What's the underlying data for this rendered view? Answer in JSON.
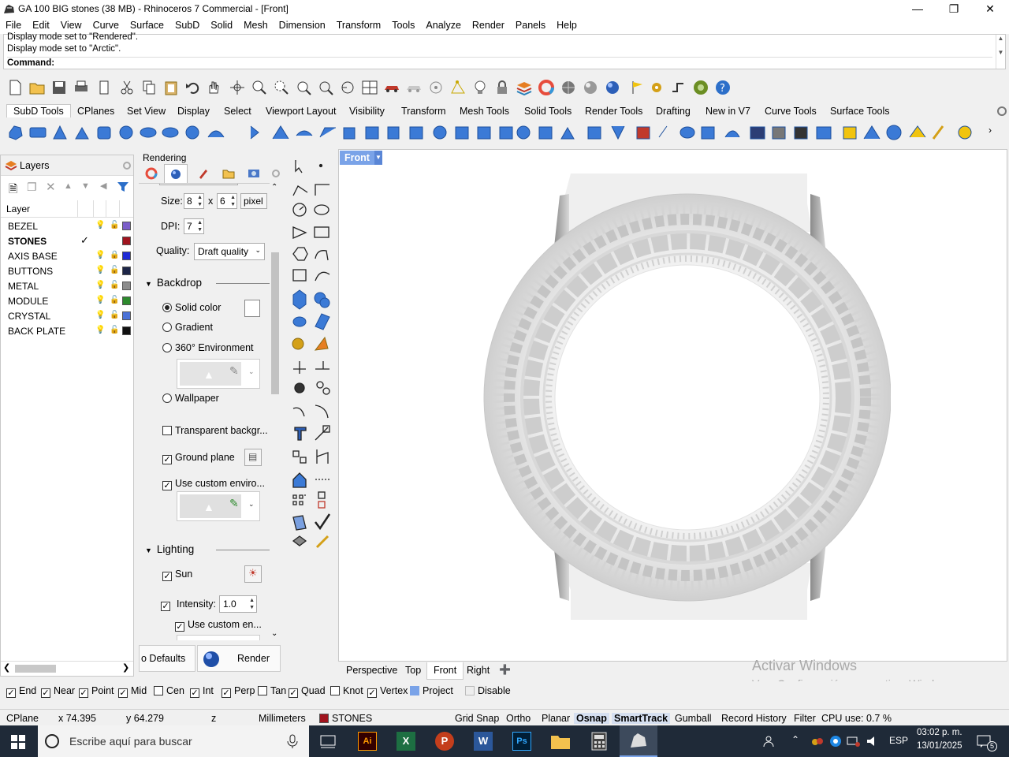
{
  "window": {
    "title": "GA 100 BIG stones (38 MB) - Rhinoceros 7 Commercial - [Front]"
  },
  "menu": [
    "File",
    "Edit",
    "View",
    "Curve",
    "Surface",
    "SubD",
    "Solid",
    "Mesh",
    "Dimension",
    "Transform",
    "Tools",
    "Analyze",
    "Render",
    "Panels",
    "Help"
  ],
  "command": {
    "history1": "Display mode set to \"Rendered\".",
    "history2": "Display mode set to \"Arctic\".",
    "prompt": "Command:"
  },
  "toolbar_tabs": [
    "SubD Tools",
    "CPlanes",
    "Set View",
    "Display",
    "Select",
    "Viewport Layout",
    "Visibility",
    "Transform",
    "Mesh Tools",
    "Solid Tools",
    "Render Tools",
    "Drafting",
    "New in V7",
    "Curve Tools",
    "Surface Tools"
  ],
  "layers": {
    "title": "Layers",
    "column_header": "Layer",
    "rows": [
      {
        "name": "BEZEL",
        "color": "#7b5ec9",
        "current": false,
        "locked": false
      },
      {
        "name": "STONES",
        "color": "#a0141e",
        "current": true,
        "locked": false
      },
      {
        "name": "AXIS BASE",
        "color": "#1f2bd6",
        "current": false,
        "locked": true
      },
      {
        "name": "BUTTONS",
        "color": "#1c2547",
        "current": false,
        "locked": false
      },
      {
        "name": "METAL",
        "color": "#8c8c8c",
        "current": false,
        "locked": false
      },
      {
        "name": "MODULE",
        "color": "#2d8a2d",
        "current": false,
        "locked": false
      },
      {
        "name": "CRYSTAL",
        "color": "#4b72d8",
        "current": false,
        "locked": false
      },
      {
        "name": "BACK PLATE",
        "color": "#111111",
        "current": false,
        "locked": false
      }
    ]
  },
  "rendering": {
    "title": "Rendering",
    "size_label": "Size:",
    "size_w": "8",
    "size_x": "x",
    "size_h": "6",
    "size_unit": "pixel",
    "dpi_label": "DPI:",
    "dpi_value": "7",
    "quality_label": "Quality:",
    "quality_value": "Draft quality",
    "backdrop_header": "Backdrop",
    "solid_color": "Solid color",
    "gradient": "Gradient",
    "env360": "360° Environment",
    "wallpaper": "Wallpaper",
    "transparent": "Transparent backgr...",
    "ground_plane": "Ground plane",
    "custom_env": "Use custom enviro...",
    "lighting_header": "Lighting",
    "sun": "Sun",
    "intensity_label": "Intensity:",
    "intensity_value": "1.0",
    "custom_env2": "Use custom en...",
    "defaults_btn": "o Defaults",
    "render_btn": "Render"
  },
  "viewport": {
    "name": "Front",
    "tabs": [
      "Perspective",
      "Top",
      "Front",
      "Right"
    ],
    "active_tab": "Front"
  },
  "watermark": {
    "line1": "Activar Windows",
    "line2": "Ve a Configuración para activar Windows."
  },
  "osnap": [
    {
      "label": "End",
      "checked": true
    },
    {
      "label": "Near",
      "checked": true
    },
    {
      "label": "Point",
      "checked": true
    },
    {
      "label": "Mid",
      "checked": true
    },
    {
      "label": "Cen",
      "checked": false
    },
    {
      "label": "Int",
      "checked": true
    },
    {
      "label": "Perp",
      "checked": true
    },
    {
      "label": "Tan",
      "checked": false
    },
    {
      "label": "Quad",
      "checked": true
    },
    {
      "label": "Knot",
      "checked": false
    },
    {
      "label": "Vertex",
      "checked": true
    },
    {
      "label": "Project",
      "checked": true
    },
    {
      "label": "Disable",
      "checked": false
    }
  ],
  "status": {
    "cplane": "CPlane",
    "x": "x 74.395",
    "y": "y 64.279",
    "z": "z",
    "units": "Millimeters",
    "layer": "STONES",
    "layer_color": "#a0141e",
    "items": [
      "Grid Snap",
      "Ortho",
      "Planar",
      "Osnap",
      "SmartTrack",
      "Gumball",
      "Record History",
      "Filter"
    ],
    "cpu": "CPU use: 0.7 %"
  },
  "taskbar": {
    "search_placeholder": "Escribe aquí para buscar",
    "lang": "ESP",
    "time": "03:02 p. m.",
    "date": "13/01/2025",
    "notif": "5"
  }
}
